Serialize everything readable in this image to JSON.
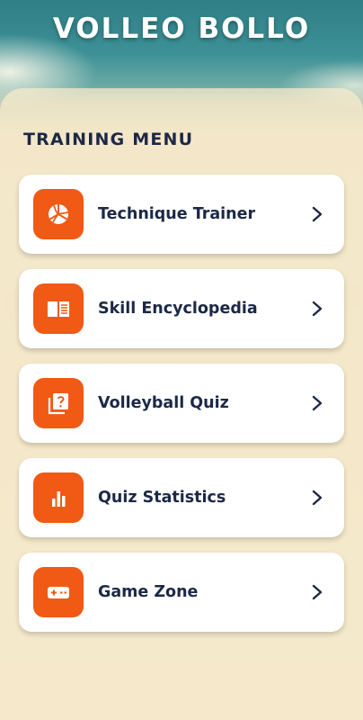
{
  "app": {
    "title": "VOLLEO BOLLO"
  },
  "section": {
    "title": "TRAINING MENU"
  },
  "menu": {
    "items": [
      {
        "label": "Technique Trainer",
        "icon": "volleyball-icon"
      },
      {
        "label": "Skill Encyclopedia",
        "icon": "open-book-icon"
      },
      {
        "label": "Volleyball Quiz",
        "icon": "quiz-question-icon"
      },
      {
        "label": "Quiz Statistics",
        "icon": "bar-chart-icon"
      },
      {
        "label": "Game Zone",
        "icon": "gamepad-icon"
      }
    ]
  },
  "colors": {
    "accent": "#f05a14",
    "text": "#1c2846",
    "card": "#ffffff",
    "header_teal": "#2f7f86"
  }
}
